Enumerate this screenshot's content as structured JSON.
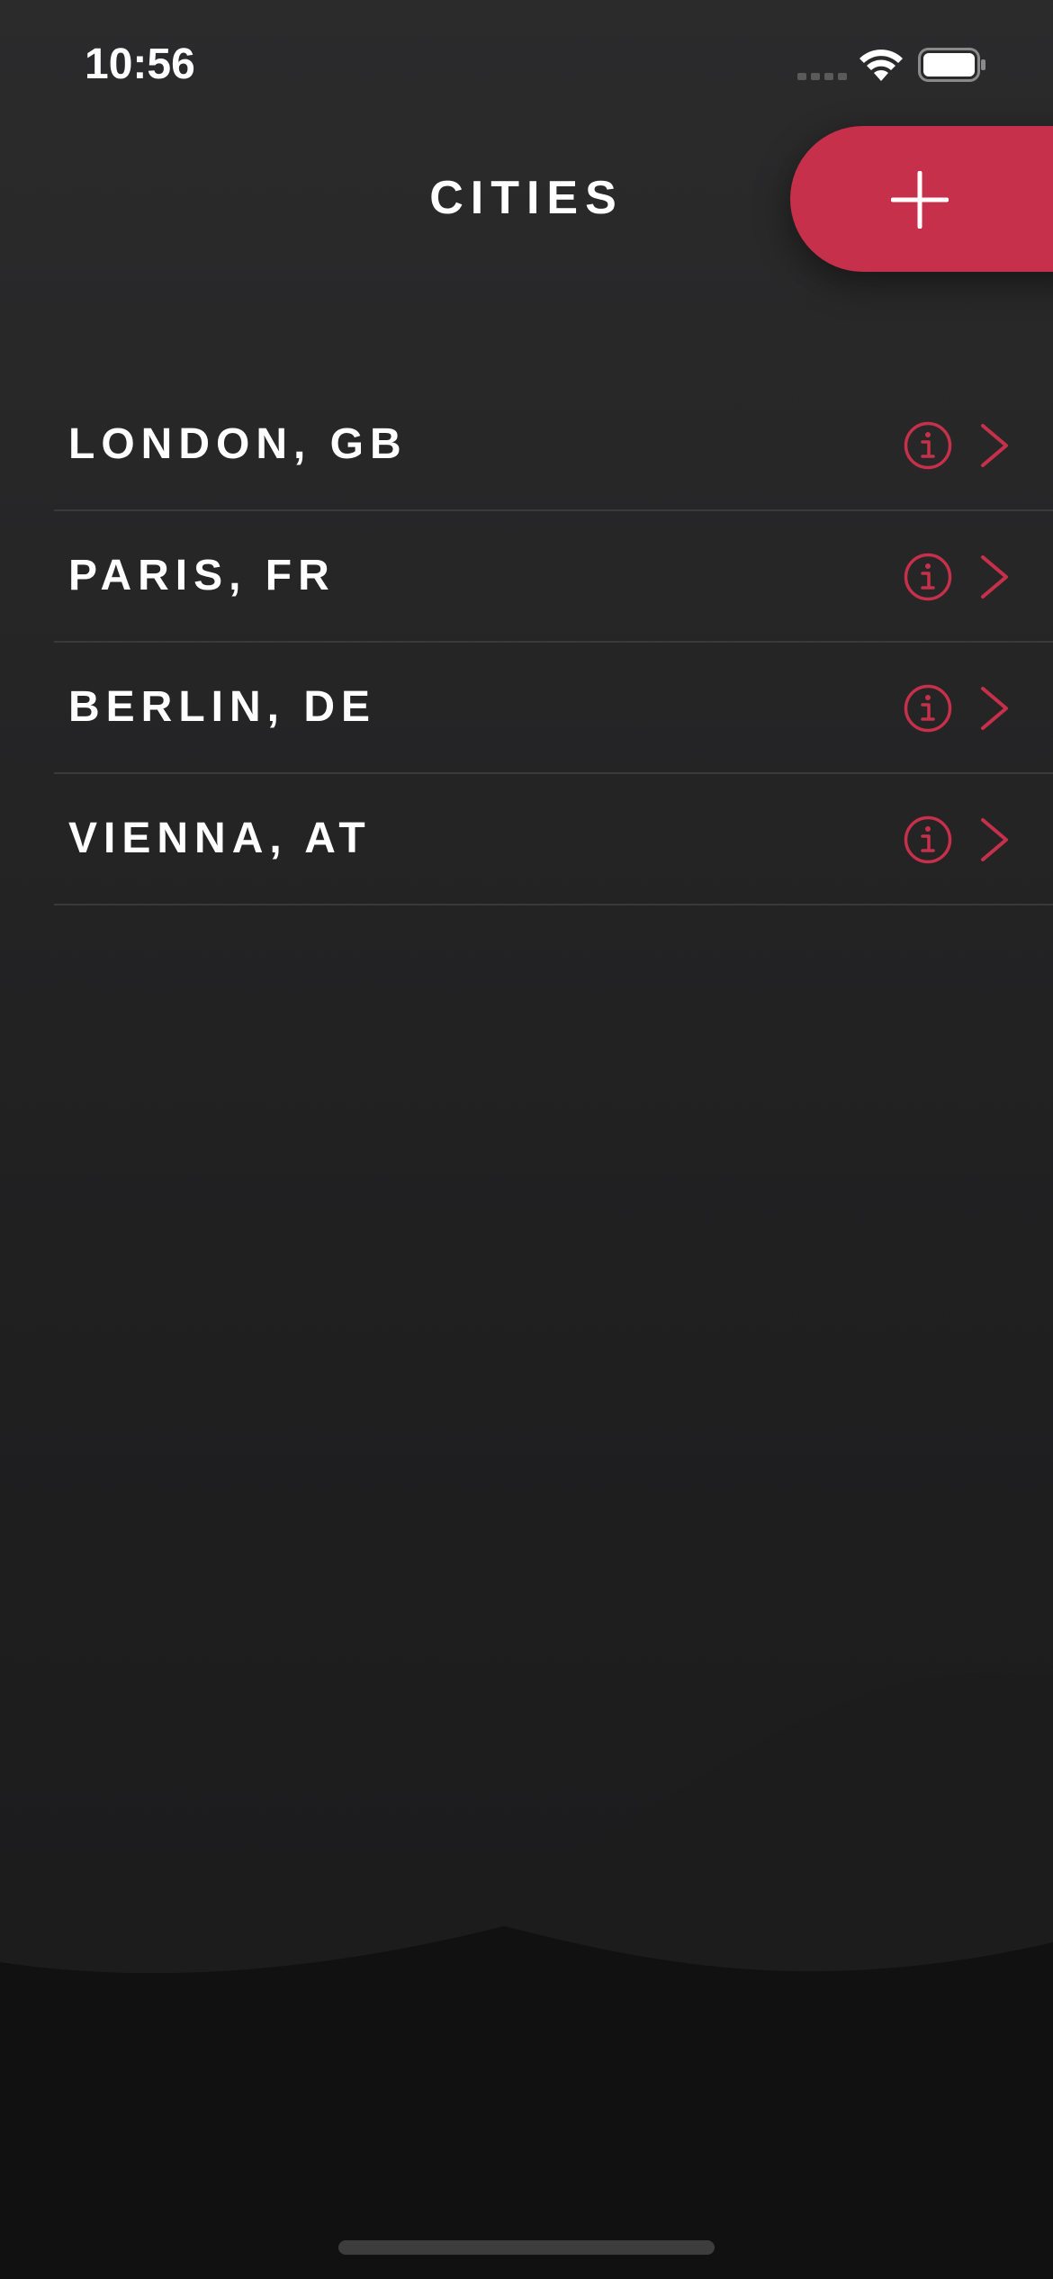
{
  "status_bar": {
    "time": "10:56",
    "icons": [
      "cellular-signal-icon",
      "wifi-icon",
      "battery-icon"
    ]
  },
  "header": {
    "title": "CITIES",
    "add_button_icon": "plus-icon"
  },
  "cities": [
    {
      "label": "LONDON, GB"
    },
    {
      "label": "PARIS, FR"
    },
    {
      "label": "BERLIN, DE"
    },
    {
      "label": "VIENNA, AT"
    }
  ],
  "row_icons": [
    "info-icon",
    "chevron-right-icon"
  ],
  "colors": {
    "accent": "#c6304a",
    "background_top": "#2b2b2c",
    "background_bottom": "#1a1a1b",
    "text": "#ffffff",
    "divider": "#3a3a3b"
  }
}
